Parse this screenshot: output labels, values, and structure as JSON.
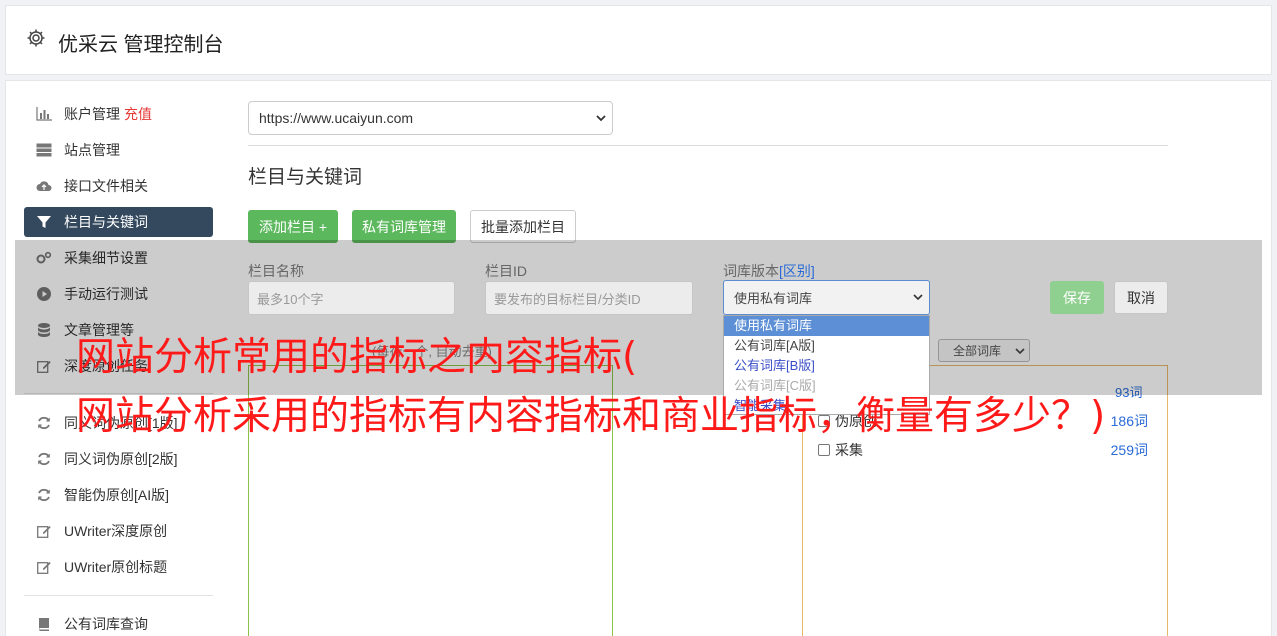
{
  "header": {
    "title": "优采云 管理控制台"
  },
  "sidebar": {
    "items": [
      {
        "label": "账户管理",
        "extra": "充值"
      },
      {
        "label": "站点管理"
      },
      {
        "label": "接口文件相关"
      },
      {
        "label": "栏目与关键词"
      },
      {
        "label": "采集细节设置"
      },
      {
        "label": "手动运行测试"
      },
      {
        "label": "文章管理等"
      },
      {
        "label": "深度原创任务"
      },
      {
        "label": "同义词伪原创[1版]"
      },
      {
        "label": "同义词伪原创[2版]"
      },
      {
        "label": "智能伪原创[AI版]"
      },
      {
        "label": "UWriter深度原创"
      },
      {
        "label": "UWriter原创标题"
      },
      {
        "label": "公有词库查询"
      }
    ]
  },
  "main": {
    "site_select": "https://www.ucaiyun.com",
    "section_title": "栏目与关键词",
    "buttons": {
      "add_column": "添加栏目 +",
      "private_lib": "私有词库管理",
      "batch_add": "批量添加栏目"
    },
    "form": {
      "name_label": "栏目名称",
      "name_placeholder": "最多10个字",
      "id_label": "栏目ID",
      "id_placeholder": "要发布的目标栏目/分类ID",
      "lib_label": "词库版本",
      "lib_label_link": "[区别]",
      "lib_value": "使用私有词库",
      "save": "保存",
      "cancel": "取消"
    },
    "dropdown_options": [
      "使用私有词库",
      "公有词库[A版]",
      "公有词库[B版]",
      "公有词库[C版]",
      "智能采集"
    ],
    "lib_filter": "全部词库",
    "behind_text": "(每行一个, 自动去重)",
    "right_rows": [
      {
        "label": "伪原创",
        "count": "186词"
      },
      {
        "label": "采集",
        "count": "259词"
      }
    ],
    "right_top_count": "93词"
  },
  "overlay_text": {
    "line1": "网站分析常用的指标之内容指标(",
    "line2": "网站分析采用的指标有内容指标和商业指标，衡量有多少？)"
  }
}
